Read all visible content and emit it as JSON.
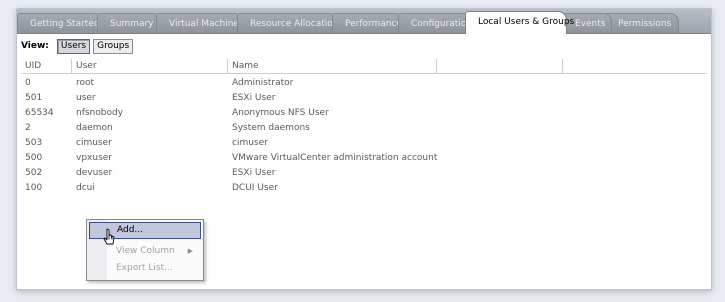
{
  "tabs": [
    {
      "label": "Getting Started"
    },
    {
      "label": "Summary"
    },
    {
      "label": "Virtual Machines"
    },
    {
      "label": "Resource Allocation"
    },
    {
      "label": "Performance"
    },
    {
      "label": "Configuration"
    },
    {
      "label": "Local Users & Groups",
      "active": true
    },
    {
      "label": "Events"
    },
    {
      "label": "Permissions"
    }
  ],
  "view": {
    "label": "View:",
    "users_label": "Users",
    "groups_label": "Groups",
    "selected": "Users"
  },
  "table": {
    "headers": {
      "uid": "UID",
      "user": "User",
      "name": "Name"
    },
    "rows": [
      {
        "uid": "0",
        "user": "root",
        "name": "Administrator"
      },
      {
        "uid": "501",
        "user": "user",
        "name": "ESXi User"
      },
      {
        "uid": "65534",
        "user": "nfsnobody",
        "name": "Anonymous NFS User"
      },
      {
        "uid": "2",
        "user": "daemon",
        "name": "System daemons"
      },
      {
        "uid": "503",
        "user": "cimuser",
        "name": "cimuser"
      },
      {
        "uid": "500",
        "user": "vpxuser",
        "name": "VMware VirtualCenter administration account"
      },
      {
        "uid": "502",
        "user": "devuser",
        "name": "ESXi User"
      },
      {
        "uid": "100",
        "user": "dcui",
        "name": "DCUI User"
      }
    ]
  },
  "context_menu": {
    "add": "Add...",
    "view_column": "View Column",
    "export_list": "Export List..."
  },
  "icons": {
    "submenu_arrow": "submenu-arrow-icon",
    "cursor": "mouse-pointer-icon"
  },
  "colors": {
    "tab_active_bg": "#ffffff",
    "menu_highlight": "#c2c7dc",
    "menu_highlight_border": "#3d4f8a"
  }
}
